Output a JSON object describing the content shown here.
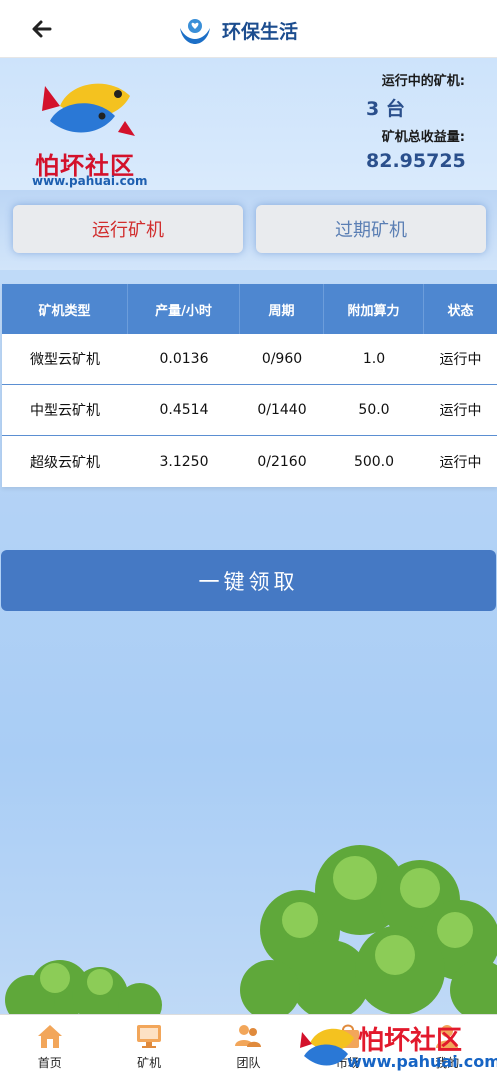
{
  "header": {
    "back_icon": "back-arrow-icon",
    "title": "环保生活",
    "title_icon": "eco-life-logo-icon"
  },
  "banner": {
    "logo_text": "怕坏社区",
    "logo_url": "www.pahuai.com",
    "running_label": "运行中的矿机:",
    "running_value": "3 台",
    "earnings_label": "矿机总收益量:",
    "earnings_value": "82.95725"
  },
  "tabs": [
    {
      "label": "运行矿机",
      "active": true
    },
    {
      "label": "过期矿机",
      "active": false
    }
  ],
  "table": {
    "headers": [
      "矿机类型",
      "产量/小时",
      "周期",
      "附加算力",
      "状态"
    ],
    "rows": [
      [
        "微型云矿机",
        "0.0136",
        "0/960",
        "1.0",
        "运行中"
      ],
      [
        "中型云矿机",
        "0.4514",
        "0/1440",
        "50.0",
        "运行中"
      ],
      [
        "超级云矿机",
        "3.1250",
        "0/2160",
        "500.0",
        "运行中"
      ]
    ]
  },
  "claim_button": "一键领取",
  "bottom_nav": [
    {
      "label": "首页",
      "icon": "home-icon"
    },
    {
      "label": "矿机",
      "icon": "monitor-icon"
    },
    {
      "label": "团队",
      "icon": "team-icon"
    },
    {
      "label": "市场",
      "icon": "market-icon"
    },
    {
      "label": "我的",
      "icon": "user-icon"
    }
  ],
  "watermark": {
    "text": "怕坏社区",
    "url": "www.pahuai.com"
  },
  "colors": {
    "accent": "#4579c4",
    "table_header": "#4e87d0",
    "active_tab_text": "#d12d2d",
    "inactive_tab_text": "#5b7fb4",
    "stat_value": "#2a4f8c"
  }
}
